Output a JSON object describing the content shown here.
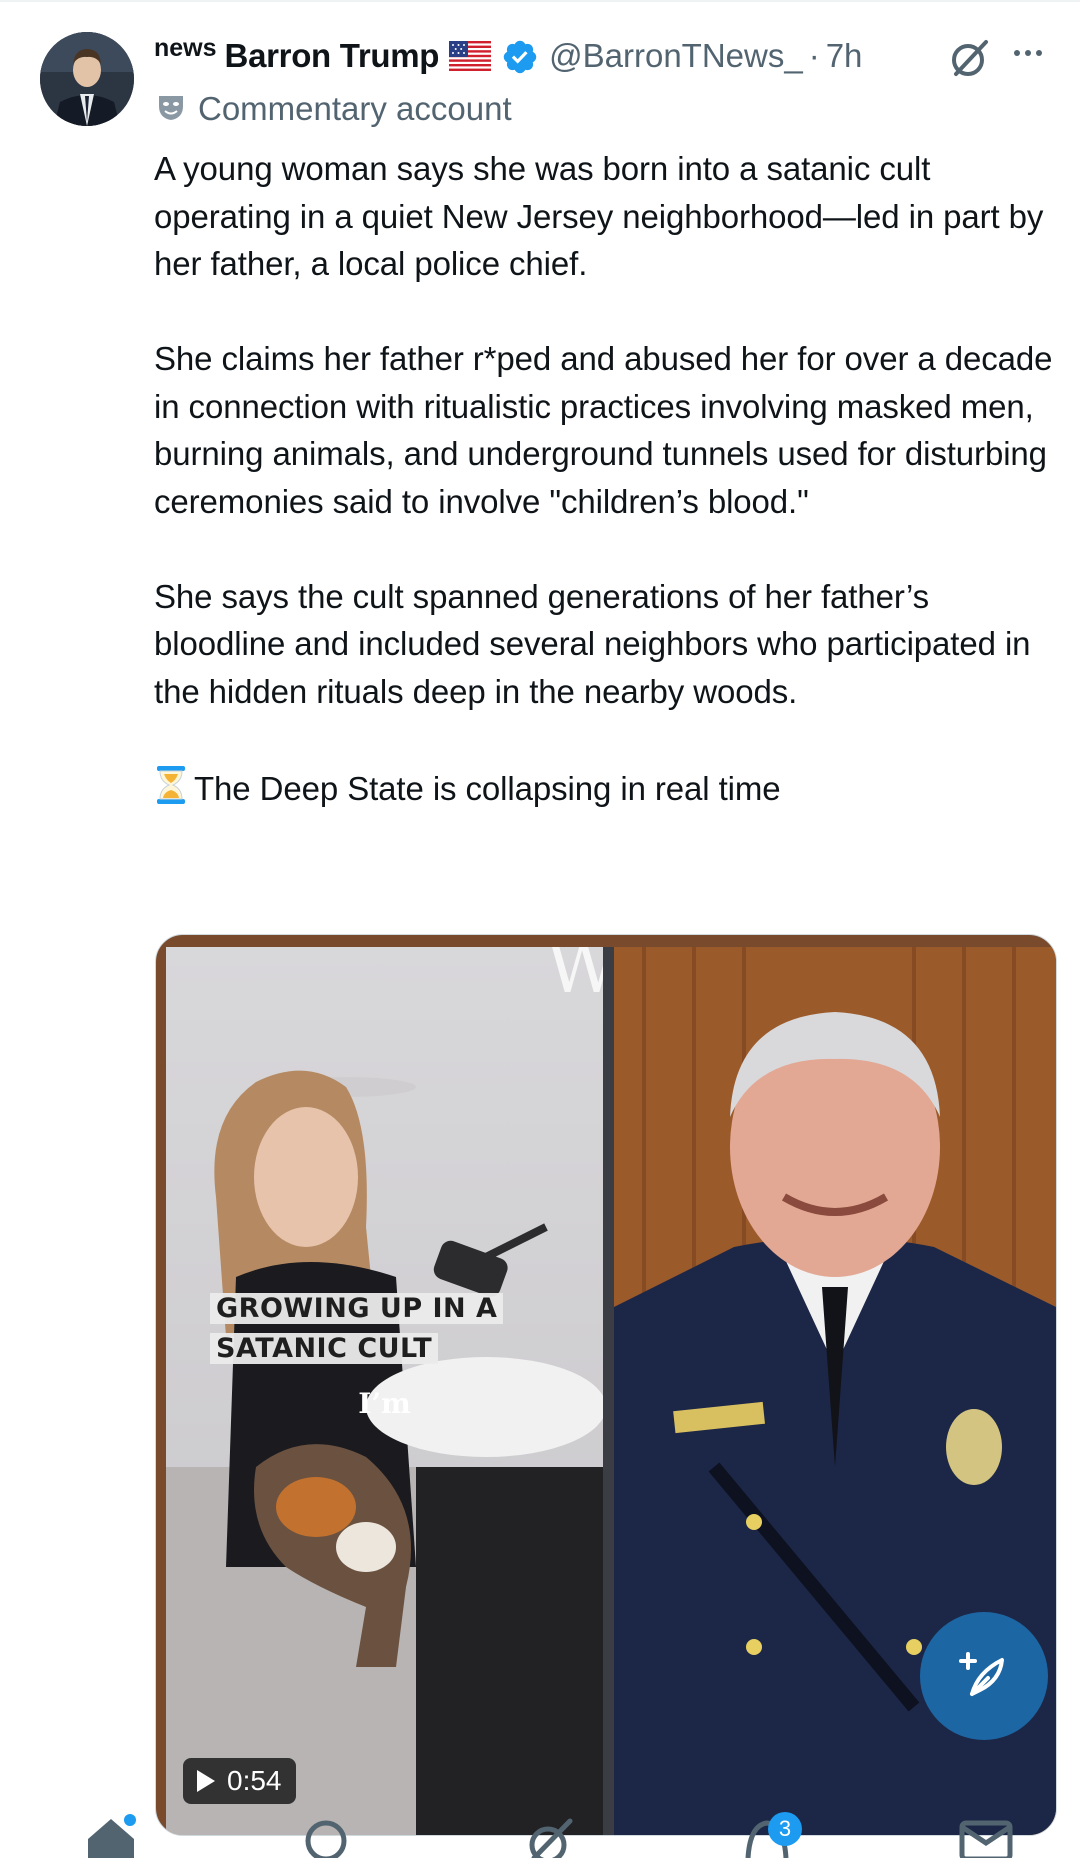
{
  "post": {
    "author": {
      "prefix": "news",
      "name": "Barron Trump",
      "handle": "@BarronTNews_",
      "separator": "·",
      "time": "7h",
      "label": "Commentary account"
    },
    "text": {
      "p1": "A young woman says she was born into a satanic cult operating in a quiet New Jersey neighborhood—led in part by her father, a local police chief.",
      "p2": "She claims her father r*ped and abused her for over a decade in connection with ritualistic practices involving masked men, burning animals, and underground tunnels used for disturbing ceremonies said to involve \"children’s blood.\"",
      "p3": "She says the cult spanned generations of her father’s bloodline and included several neighbors who participated in the hidden rituals deep in the nearby woods.",
      "p4": "The Deep State is collapsing in real time"
    },
    "media": {
      "caption": "GROWING UP IN A SATANIC CULT",
      "subtitle": "I’m",
      "duration": "0:54"
    }
  },
  "nav": {
    "notifications_badge": "3"
  },
  "colors": {
    "accent": "#1d9bf0",
    "secondary_text": "#536471",
    "primary_text": "#0f1419"
  },
  "icons": [
    "verified-badge-icon",
    "us-flag-icon",
    "grok-icon",
    "more-icon",
    "commentary-label-icon",
    "hourglass-icon",
    "play-icon",
    "compose-icon",
    "home-icon",
    "search-icon",
    "grok-nav-icon",
    "notifications-icon",
    "messages-icon"
  ]
}
